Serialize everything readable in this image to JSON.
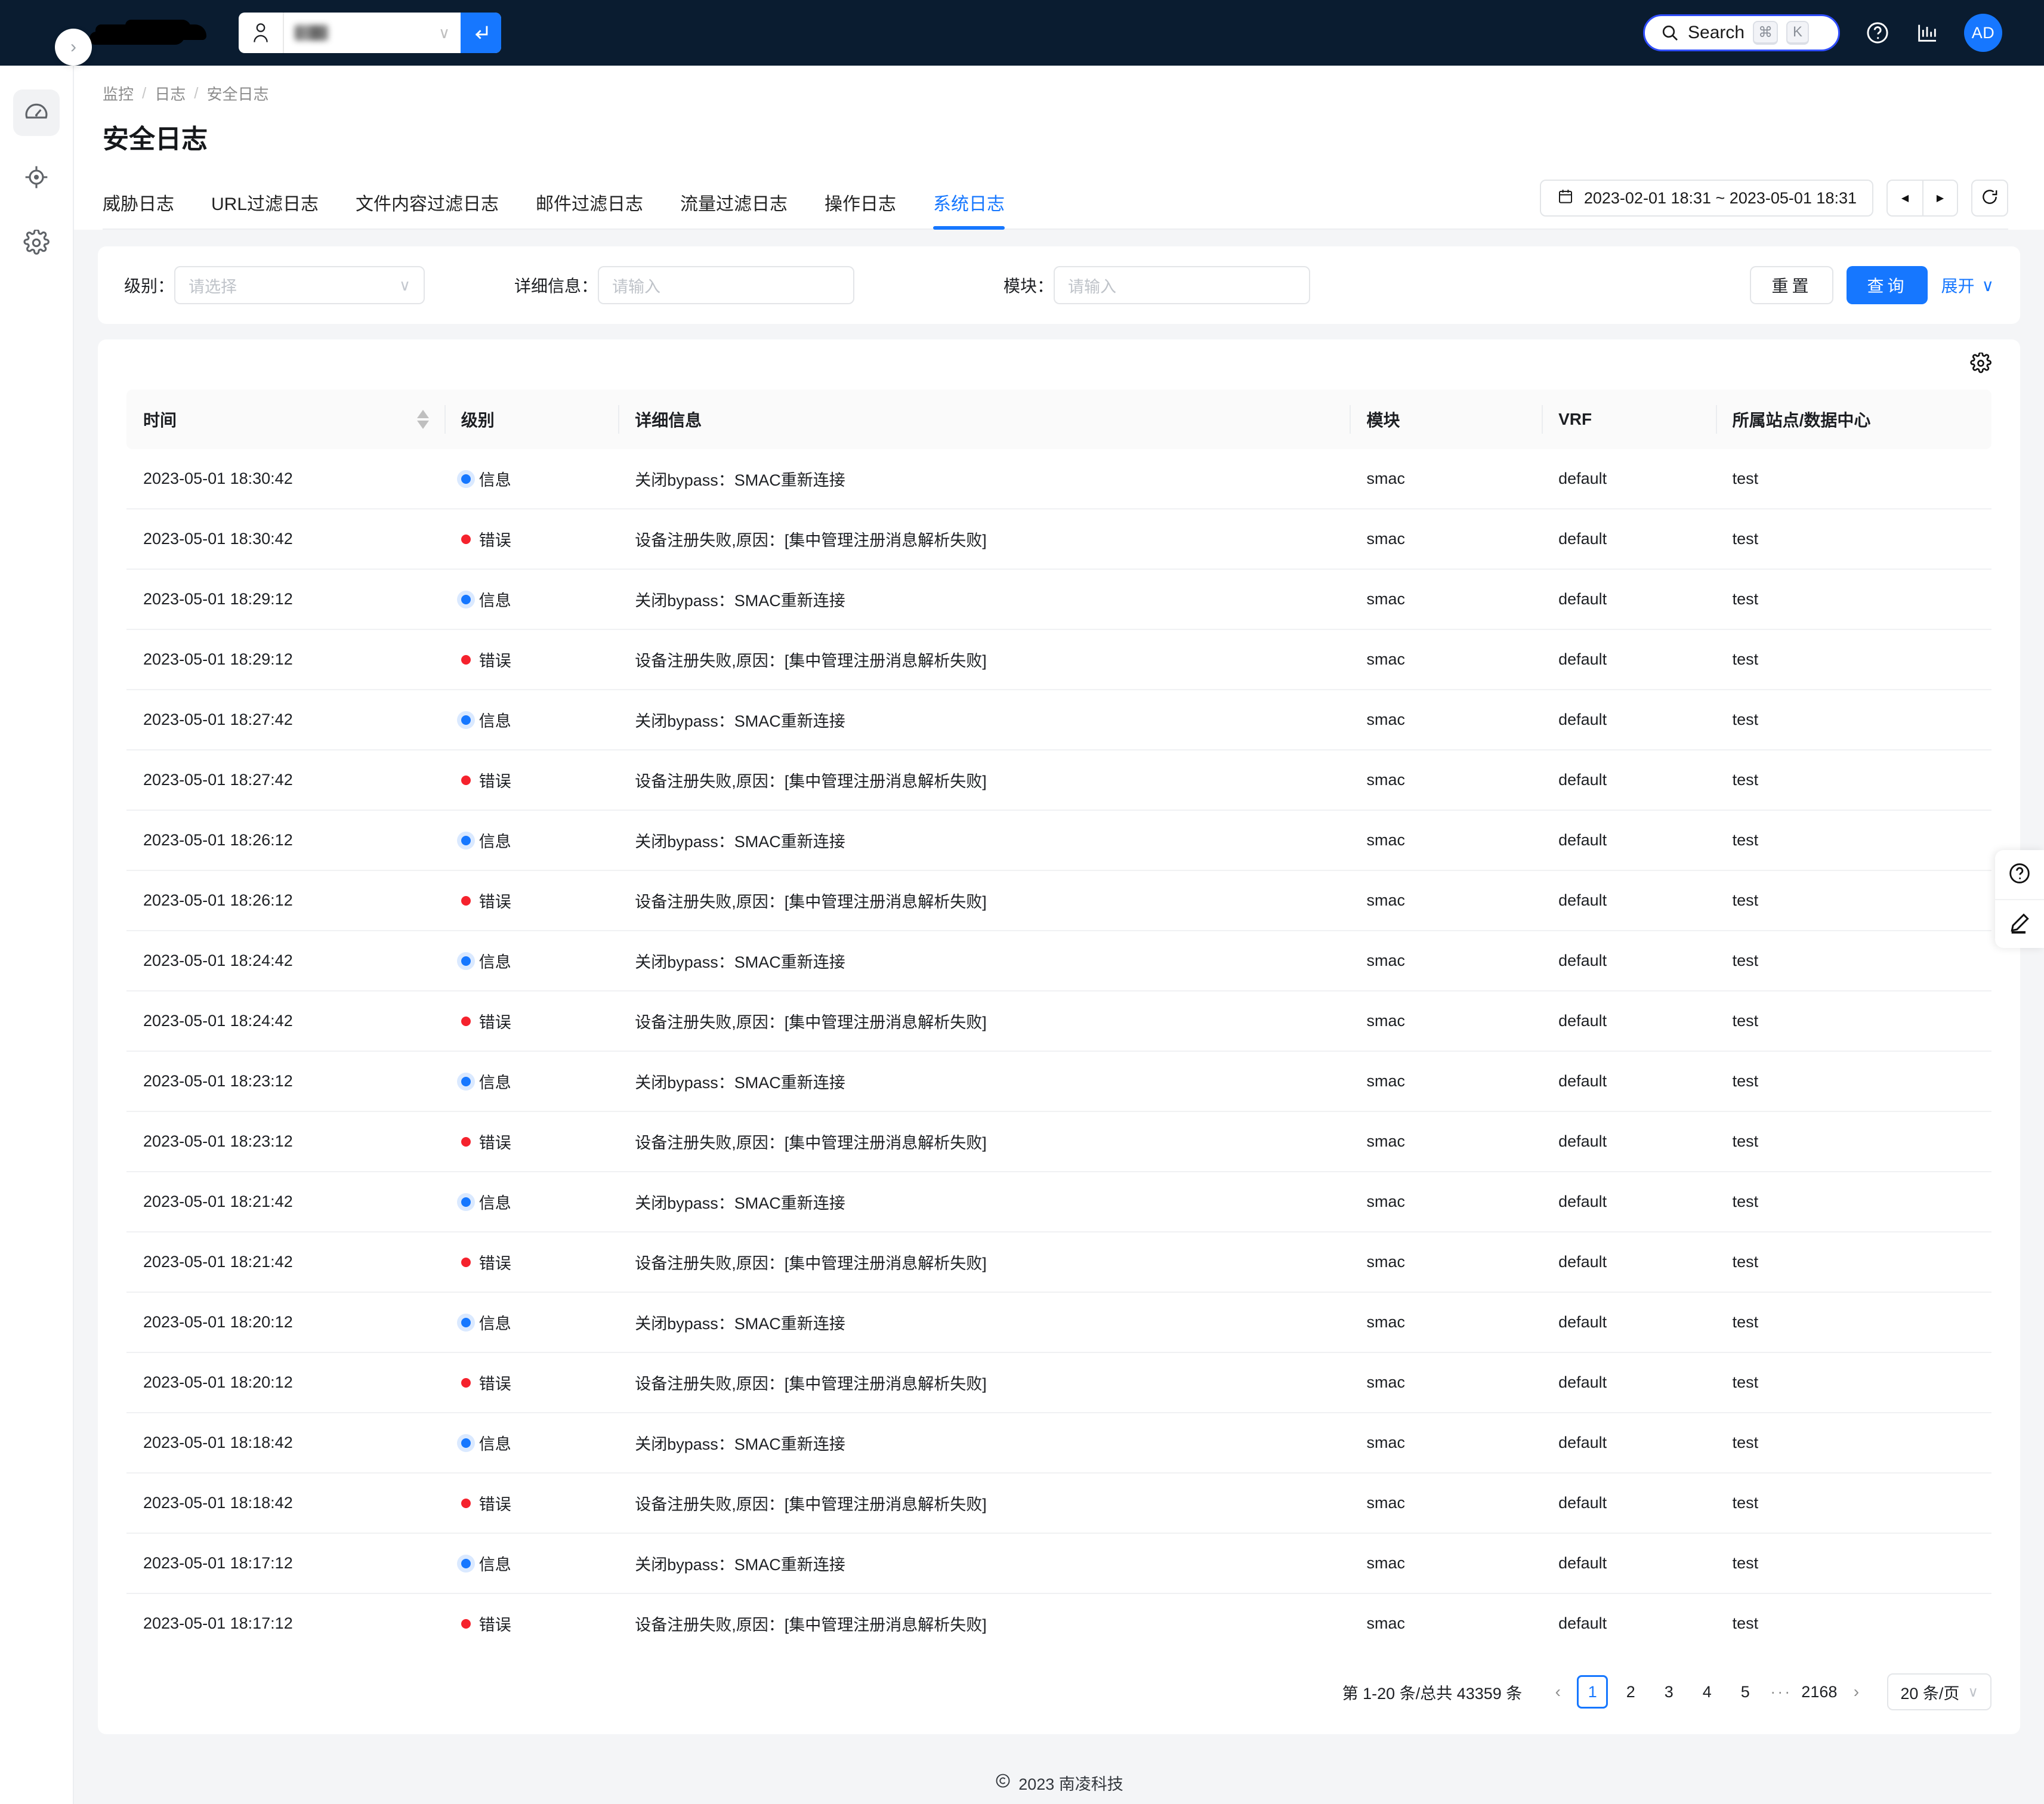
{
  "topbar": {
    "logo_alt": "redacted-logo",
    "user_select": {
      "value": "",
      "caret": "∨",
      "icon": "user-icon",
      "submit_icon": "enter-arrow-icon"
    },
    "search": {
      "label": "Search",
      "kbd1": "⌘",
      "kbd2": "K"
    },
    "help_icon": "question-circle-icon",
    "stats_icon": "bar-chart-icon",
    "avatar": "AD",
    "brand_color": "#1677ff",
    "bg_color": "#0a1c30"
  },
  "rail": {
    "items": [
      {
        "icon": "dashboard-gauge-icon",
        "active": true
      },
      {
        "icon": "target-crosshair-icon",
        "active": false
      },
      {
        "icon": "gear-icon",
        "active": false
      }
    ],
    "collapse_icon": "chevron-right-icon"
  },
  "header": {
    "breadcrumb": [
      "监控",
      "日志",
      "安全日志"
    ],
    "separator": "/",
    "title": "安全日志"
  },
  "tabs": [
    {
      "label": "威胁日志",
      "active": false
    },
    {
      "label": "URL过滤日志",
      "active": false
    },
    {
      "label": "文件内容过滤日志",
      "active": false
    },
    {
      "label": "邮件过滤日志",
      "active": false
    },
    {
      "label": "流量过滤日志",
      "active": false
    },
    {
      "label": "操作日志",
      "active": false
    },
    {
      "label": "系统日志",
      "active": true
    }
  ],
  "head_tools": {
    "date_range": "2023-02-01 18:31 ~ 2023-05-01 18:31",
    "calendar_icon": "calendar-icon",
    "prev_icon": "◀",
    "next_icon": "▶",
    "refresh_icon": "refresh-icon"
  },
  "filters": {
    "level": {
      "label": "级别：",
      "placeholder": "请选择",
      "value": "",
      "caret": "∨"
    },
    "detail": {
      "label": "详细信息：",
      "placeholder": "请输入",
      "value": ""
    },
    "module": {
      "label": "模块：",
      "placeholder": "请输入",
      "value": ""
    },
    "reset_label": "重置",
    "query_label": "查询",
    "expand_label": "展开",
    "expand_caret": "∨"
  },
  "table": {
    "settings_icon": "gear-icon",
    "columns": [
      {
        "key": "time",
        "label": "时间",
        "sortable": true
      },
      {
        "key": "level",
        "label": "级别",
        "sortable": false
      },
      {
        "key": "detail",
        "label": "详细信息",
        "sortable": false
      },
      {
        "key": "module",
        "label": "模块",
        "sortable": false
      },
      {
        "key": "vrf",
        "label": "VRF",
        "sortable": false
      },
      {
        "key": "site",
        "label": "所属站点/数据中心",
        "sortable": false
      }
    ],
    "level_info_label": "信息",
    "level_error_label": "错误",
    "info_color": "#1677ff",
    "error_color": "#f5222d",
    "rows": [
      {
        "time": "2023-05-01 18:30:42",
        "level": "info",
        "detail": "关闭bypass：SMAC重新连接",
        "module": "smac",
        "vrf": "default",
        "site": "test"
      },
      {
        "time": "2023-05-01 18:30:42",
        "level": "error",
        "detail": "设备注册失败,原因：[集中管理注册消息解析失败]",
        "module": "smac",
        "vrf": "default",
        "site": "test"
      },
      {
        "time": "2023-05-01 18:29:12",
        "level": "info",
        "detail": "关闭bypass：SMAC重新连接",
        "module": "smac",
        "vrf": "default",
        "site": "test"
      },
      {
        "time": "2023-05-01 18:29:12",
        "level": "error",
        "detail": "设备注册失败,原因：[集中管理注册消息解析失败]",
        "module": "smac",
        "vrf": "default",
        "site": "test"
      },
      {
        "time": "2023-05-01 18:27:42",
        "level": "info",
        "detail": "关闭bypass：SMAC重新连接",
        "module": "smac",
        "vrf": "default",
        "site": "test"
      },
      {
        "time": "2023-05-01 18:27:42",
        "level": "error",
        "detail": "设备注册失败,原因：[集中管理注册消息解析失败]",
        "module": "smac",
        "vrf": "default",
        "site": "test"
      },
      {
        "time": "2023-05-01 18:26:12",
        "level": "info",
        "detail": "关闭bypass：SMAC重新连接",
        "module": "smac",
        "vrf": "default",
        "site": "test"
      },
      {
        "time": "2023-05-01 18:26:12",
        "level": "error",
        "detail": "设备注册失败,原因：[集中管理注册消息解析失败]",
        "module": "smac",
        "vrf": "default",
        "site": "test"
      },
      {
        "time": "2023-05-01 18:24:42",
        "level": "info",
        "detail": "关闭bypass：SMAC重新连接",
        "module": "smac",
        "vrf": "default",
        "site": "test"
      },
      {
        "time": "2023-05-01 18:24:42",
        "level": "error",
        "detail": "设备注册失败,原因：[集中管理注册消息解析失败]",
        "module": "smac",
        "vrf": "default",
        "site": "test"
      },
      {
        "time": "2023-05-01 18:23:12",
        "level": "info",
        "detail": "关闭bypass：SMAC重新连接",
        "module": "smac",
        "vrf": "default",
        "site": "test"
      },
      {
        "time": "2023-05-01 18:23:12",
        "level": "error",
        "detail": "设备注册失败,原因：[集中管理注册消息解析失败]",
        "module": "smac",
        "vrf": "default",
        "site": "test"
      },
      {
        "time": "2023-05-01 18:21:42",
        "level": "info",
        "detail": "关闭bypass：SMAC重新连接",
        "module": "smac",
        "vrf": "default",
        "site": "test"
      },
      {
        "time": "2023-05-01 18:21:42",
        "level": "error",
        "detail": "设备注册失败,原因：[集中管理注册消息解析失败]",
        "module": "smac",
        "vrf": "default",
        "site": "test"
      },
      {
        "time": "2023-05-01 18:20:12",
        "level": "info",
        "detail": "关闭bypass：SMAC重新连接",
        "module": "smac",
        "vrf": "default",
        "site": "test"
      },
      {
        "time": "2023-05-01 18:20:12",
        "level": "error",
        "detail": "设备注册失败,原因：[集中管理注册消息解析失败]",
        "module": "smac",
        "vrf": "default",
        "site": "test"
      },
      {
        "time": "2023-05-01 18:18:42",
        "level": "info",
        "detail": "关闭bypass：SMAC重新连接",
        "module": "smac",
        "vrf": "default",
        "site": "test"
      },
      {
        "time": "2023-05-01 18:18:42",
        "level": "error",
        "detail": "设备注册失败,原因：[集中管理注册消息解析失败]",
        "module": "smac",
        "vrf": "default",
        "site": "test"
      },
      {
        "time": "2023-05-01 18:17:12",
        "level": "info",
        "detail": "关闭bypass：SMAC重新连接",
        "module": "smac",
        "vrf": "default",
        "site": "test"
      },
      {
        "time": "2023-05-01 18:17:12",
        "level": "error",
        "detail": "设备注册失败,原因：[集中管理注册消息解析失败]",
        "module": "smac",
        "vrf": "default",
        "site": "test"
      }
    ]
  },
  "pagination": {
    "total_text": "第 1-20 条/总共 43359 条",
    "prev": "‹",
    "next": "›",
    "pages": [
      "1",
      "2",
      "3",
      "4",
      "5"
    ],
    "ellipsis": "···",
    "last_page": "2168",
    "current": "1",
    "page_size": "20 条/页",
    "page_size_caret": "∨"
  },
  "float_side": {
    "help_icon": "question-circle-icon",
    "edit_icon": "pencil-icon"
  },
  "footer": {
    "copyright_mark": "©",
    "text": "2023 南凌科技"
  }
}
